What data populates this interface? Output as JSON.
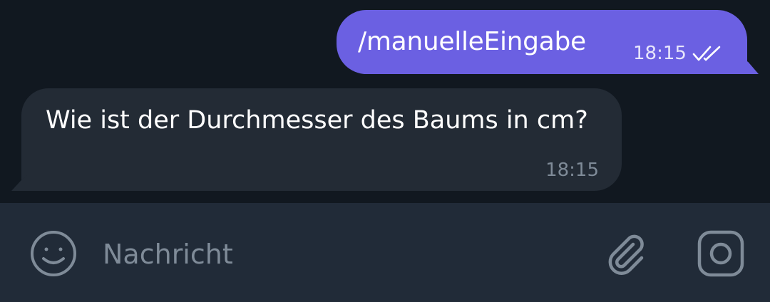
{
  "messages": [
    {
      "direction": "outgoing",
      "text": "/manuelleEingabe",
      "time": "18:15",
      "status": "read"
    },
    {
      "direction": "incoming",
      "text": "Wie ist der Durchmesser des Baums in cm?",
      "time": "18:15"
    }
  ],
  "input": {
    "placeholder": "Nachricht",
    "icons": [
      "emoji-icon",
      "attach-icon",
      "camera-icon"
    ]
  },
  "colors": {
    "background": "#111820",
    "outgoing_bubble": "#6b60e2",
    "incoming_bubble": "#232b35",
    "input_bar": "#212b38",
    "muted": "#7f8b98"
  }
}
